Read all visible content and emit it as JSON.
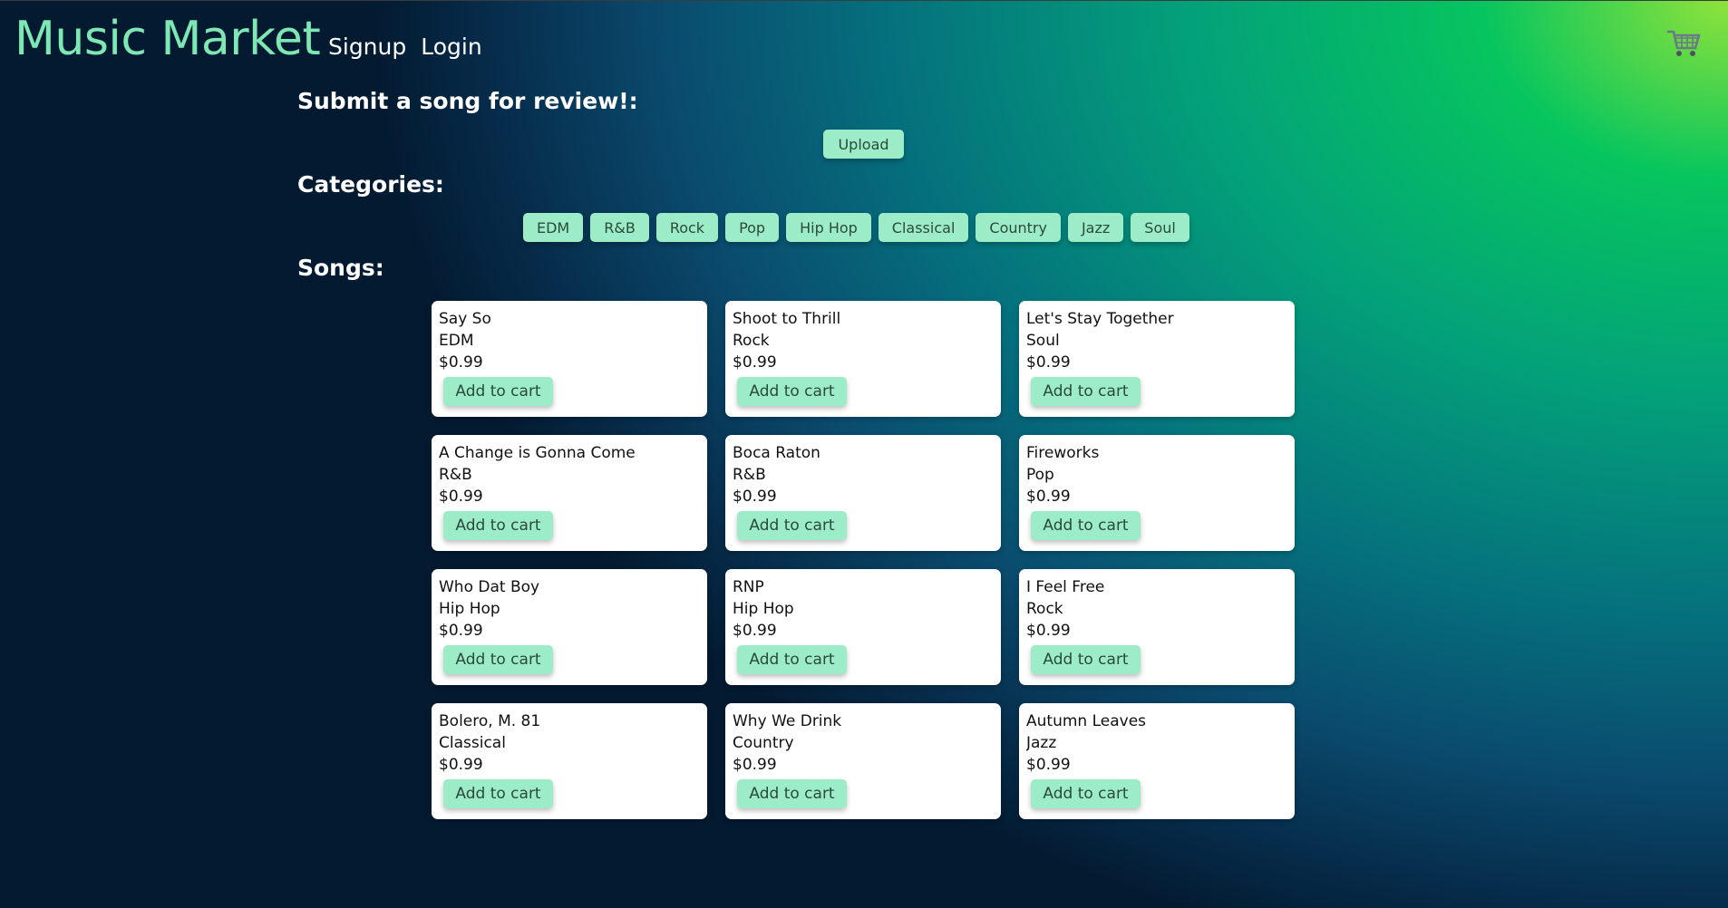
{
  "brand": "Music Market",
  "nav": {
    "signup": "Signup",
    "login": "Login"
  },
  "cart_icon": "shopping-cart-icon",
  "upload_section": {
    "title": "Submit a song for review!:",
    "button_label": "Upload"
  },
  "categories_section": {
    "title": "Categories:",
    "items": [
      "EDM",
      "R&B",
      "Rock",
      "Pop",
      "Hip Hop",
      "Classical",
      "Country",
      "Jazz",
      "Soul"
    ]
  },
  "songs_section": {
    "title": "Songs:",
    "add_label": "Add to cart",
    "songs": [
      {
        "title": "Say So",
        "category": "EDM",
        "price": "$0.99"
      },
      {
        "title": "Shoot to Thrill",
        "category": "Rock",
        "price": "$0.99"
      },
      {
        "title": "Let's Stay Together",
        "category": "Soul",
        "price": "$0.99"
      },
      {
        "title": "A Change is Gonna Come",
        "category": "R&B",
        "price": "$0.99"
      },
      {
        "title": "Boca Raton",
        "category": "R&B",
        "price": "$0.99"
      },
      {
        "title": "Fireworks",
        "category": "Pop",
        "price": "$0.99"
      },
      {
        "title": "Who Dat Boy",
        "category": "Hip Hop",
        "price": "$0.99"
      },
      {
        "title": "RNP",
        "category": "Hip Hop",
        "price": "$0.99"
      },
      {
        "title": "I Feel Free",
        "category": "Rock",
        "price": "$0.99"
      },
      {
        "title": "Bolero, M. 81",
        "category": "Classical",
        "price": "$0.99"
      },
      {
        "title": "Why We Drink",
        "category": "Country",
        "price": "$0.99"
      },
      {
        "title": "Autumn Leaves",
        "category": "Jazz",
        "price": "$0.99"
      }
    ]
  },
  "colors": {
    "brand": "#7ee8b5",
    "button_bg": "#9cecc8",
    "button_text": "#2a4a3a",
    "card_bg": "#ffffff"
  }
}
